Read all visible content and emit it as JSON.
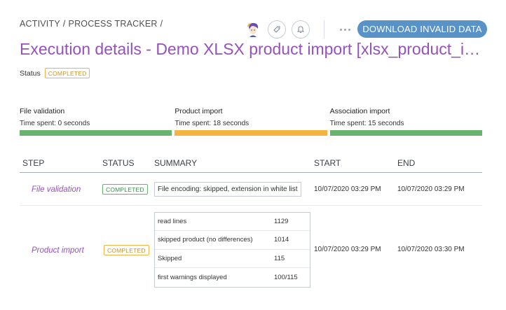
{
  "breadcrumb": [
    "Activity",
    "/",
    "Process tracker",
    "/"
  ],
  "header": {
    "download_label": "Download invalid data",
    "title": "Execution details - Demo XLSX product import [xlsx_product_import]"
  },
  "status": {
    "label": "Status",
    "value": "COMPLETED",
    "color": "#f0b54a"
  },
  "steps": [
    {
      "name": "File validation",
      "time": "Time spent: 0 seconds",
      "color": "#67b36f"
    },
    {
      "name": "Product import",
      "time": "Time spent: 18 seconds",
      "color": "#f5b442"
    },
    {
      "name": "Association import",
      "time": "Time spent: 15 seconds",
      "color": "#67b36f"
    }
  ],
  "table": {
    "headers": [
      "Step",
      "Status",
      "Summary",
      "Start",
      "End"
    ],
    "rows": [
      {
        "step": "File validation",
        "status": "COMPLETED",
        "status_color": "#67b36f",
        "summary_text": "File encoding:   skipped, extension in white list",
        "start": "10/07/2020 03:29 PM",
        "end": "10/07/2020 03:29 PM"
      },
      {
        "step": "Product import",
        "status": "COMPLETED",
        "status_color": "#f0b54a",
        "summary": [
          {
            "key": "read lines",
            "value": "1129"
          },
          {
            "key": "skipped product (no differences)",
            "value": "1014"
          },
          {
            "key": "Skipped",
            "value": "115"
          },
          {
            "key": "first warnings displayed",
            "value": "100/115"
          }
        ],
        "start": "10/07/2020 03:29 PM",
        "end": "10/07/2020 03:30 PM"
      }
    ]
  },
  "icons": {
    "avatar": "user-avatar",
    "tag": "tag-icon",
    "bell": "bell-icon",
    "more": "more-horizontal-icon"
  },
  "accent": "#9452ba",
  "primary": "#5992c7"
}
